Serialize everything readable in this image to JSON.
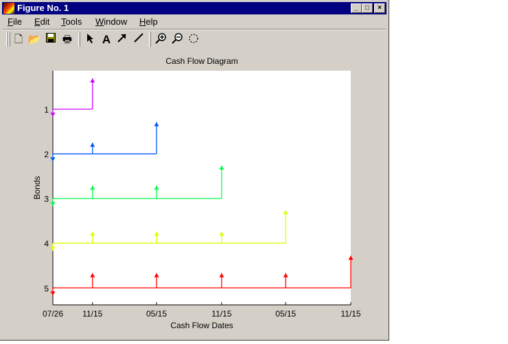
{
  "window": {
    "title": "Figure No. 1"
  },
  "menu": [
    {
      "label": "File",
      "u": "F",
      "rest": "ile"
    },
    {
      "label": "Edit",
      "u": "E",
      "rest": "dit"
    },
    {
      "label": "Tools",
      "u": "T",
      "rest": "ools"
    },
    {
      "label": "Window",
      "u": "W",
      "rest": "indow"
    },
    {
      "label": "Help",
      "u": "H",
      "rest": "elp"
    }
  ],
  "toolbar": [
    "new-file-icon",
    "open-folder-icon",
    "save-icon",
    "print-icon",
    "select-arrow-icon",
    "insert-text-icon",
    "insert-arrow-icon",
    "insert-line-icon",
    "zoom-in-icon",
    "zoom-out-icon",
    "rotate-3d-icon"
  ],
  "chart_data": {
    "type": "cash-flow",
    "title": "Cash Flow Diagram",
    "xlabel": "Cash Flow Dates",
    "ylabel": "Bonds",
    "x_ticks": [
      {
        "day": 0,
        "label": "07/26"
      },
      {
        "day": 112,
        "label": "11/15"
      },
      {
        "day": 293,
        "label": "05/15"
      },
      {
        "day": 477,
        "label": "11/15"
      },
      {
        "day": 658,
        "label": "05/15"
      },
      {
        "day": 842,
        "label": "11/15"
      }
    ],
    "y_ticks": [
      "1",
      "2",
      "3",
      "4",
      "5"
    ],
    "xlim": [
      0,
      842
    ],
    "ylim": [
      0.14,
      5.38
    ],
    "y_reversed": true,
    "series": [
      {
        "name": "Bond 1",
        "row": 1,
        "color": "#cc00ff",
        "outflow": 0.17,
        "flows": [
          {
            "day": 112,
            "amount": 0.69
          }
        ]
      },
      {
        "name": "Bond 2",
        "row": 2,
        "color": "#0055ff",
        "outflow": 0.17,
        "flows": [
          {
            "day": 112,
            "amount": 0.25
          },
          {
            "day": 293,
            "amount": 0.71
          }
        ]
      },
      {
        "name": "Bond 3",
        "row": 3,
        "color": "#00ff44",
        "outflow": 0.17,
        "flows": [
          {
            "day": 112,
            "amount": 0.29
          },
          {
            "day": 293,
            "amount": 0.29
          },
          {
            "day": 477,
            "amount": 0.74
          }
        ]
      },
      {
        "name": "Bond 4",
        "row": 4,
        "color": "#ddff00",
        "outflow": 0.17,
        "flows": [
          {
            "day": 112,
            "amount": 0.26
          },
          {
            "day": 293,
            "amount": 0.26
          },
          {
            "day": 477,
            "amount": 0.26
          },
          {
            "day": 658,
            "amount": 0.74
          }
        ]
      },
      {
        "name": "Bond 5",
        "row": 5,
        "color": "#ff0000",
        "outflow": 0.17,
        "flows": [
          {
            "day": 112,
            "amount": 0.33
          },
          {
            "day": 293,
            "amount": 0.33
          },
          {
            "day": 477,
            "amount": 0.33
          },
          {
            "day": 658,
            "amount": 0.33
          },
          {
            "day": 842,
            "amount": 0.72
          }
        ]
      }
    ]
  }
}
